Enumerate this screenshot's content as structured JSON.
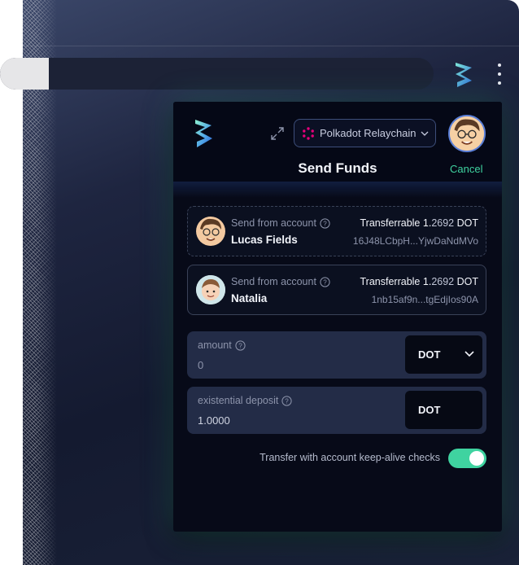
{
  "popup": {
    "network": "Polkadot Relaychain",
    "title": "Send Funds",
    "cancel": "Cancel"
  },
  "accounts": [
    {
      "from_label": "Send from account",
      "name": "Lucas Fields",
      "balance_label": "Transferrable",
      "balance_int": "1.",
      "balance_dec": "2692",
      "balance_unit": "DOT",
      "address": "16J48LCbpH...YjwDaNdMVo"
    },
    {
      "from_label": "Send from account",
      "name": "Natalia",
      "balance_label": "Transferrable",
      "balance_int": "1.",
      "balance_dec": "2692",
      "balance_unit": "DOT",
      "address": "1nb15af9n...tgEdjIos90A"
    }
  ],
  "amount": {
    "label": "amount",
    "value": "0",
    "unit": "DOT"
  },
  "deposit": {
    "label": "existential deposit",
    "value": "1.0000",
    "unit": "DOT"
  },
  "keep_alive": {
    "label": "Transfer with account keep-alive checks",
    "on": true
  },
  "colors": {
    "accent": "#3fd3a0",
    "network_ring": "#e6007a",
    "panel": "#070a18"
  }
}
